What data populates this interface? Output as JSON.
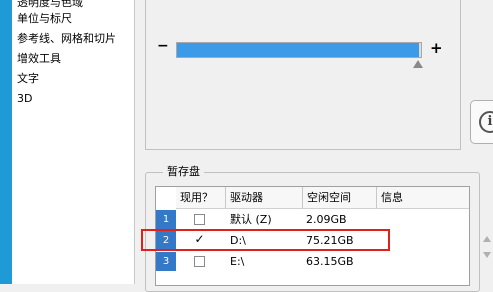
{
  "nav": {
    "items": [
      {
        "label": "透明度与色域"
      },
      {
        "label": "单位与标尺"
      },
      {
        "label": "参考线、网格和切片"
      },
      {
        "label": "增效工具"
      },
      {
        "label": "文字"
      },
      {
        "label": "3D"
      }
    ]
  },
  "memory": {
    "minus_label": "−",
    "plus_label": "+",
    "slider_level_percent": 99
  },
  "scratch": {
    "group_title": "暂存盘",
    "headers": [
      "现用？",
      "驱动器",
      "空闲空间",
      "信息"
    ],
    "rows": [
      {
        "index": "1",
        "checked": false,
        "check_mark": "",
        "drive": "默认 (Z)",
        "free": "2.09GB",
        "info": ""
      },
      {
        "index": "2",
        "checked": true,
        "check_mark": "✓",
        "drive": "D:\\",
        "free": "75.21GB",
        "info": ""
      },
      {
        "index": "3",
        "checked": false,
        "check_mark": "",
        "drive": "E:\\",
        "free": "63.15GB",
        "info": ""
      }
    ]
  },
  "colors": {
    "accent": "#3c9be8",
    "row_index": "#3478c8",
    "highlight": "#e0201a"
  }
}
